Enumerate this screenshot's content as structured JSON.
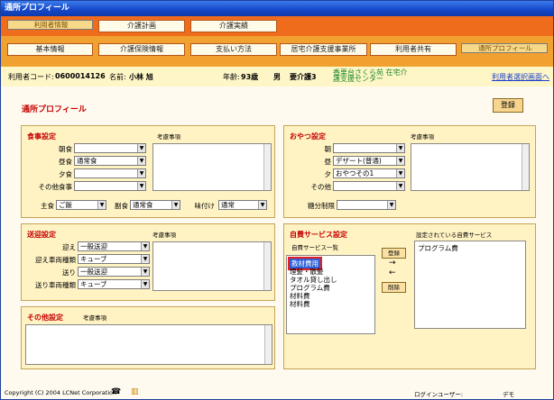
{
  "window": {
    "title": "通所プロフィール"
  },
  "tabs_row1": [
    "利用者情報",
    "介護計画",
    "介護実績"
  ],
  "tabs_row2": [
    "基本情報",
    "介護保険情報",
    "支払い方法",
    "居宅介護支援事業所",
    "利用者共有",
    "通所プロフィール"
  ],
  "user": {
    "code_label": "利用者コード:",
    "code": "0600014126",
    "name_label": "名前:",
    "name": "小林 旭",
    "age_label": "年齢:",
    "age": "93歳",
    "gender": "男",
    "care_level": "要介護3",
    "office": "香栗台さくら苑 在宅介護支援センター",
    "select_link": "利用者選択画面へ"
  },
  "page_title": "通所プロフィール",
  "register_button": "登録",
  "meal": {
    "heading": "食事設定",
    "note": "考慮事項",
    "rows": [
      {
        "label": "朝食",
        "value": ""
      },
      {
        "label": "昼食",
        "value": "通常食"
      },
      {
        "label": "夕食",
        "value": ""
      },
      {
        "label": "その他食事",
        "value": ""
      }
    ],
    "staple_label": "主食",
    "staple": "ご飯",
    "side_label": "副食",
    "side": "通常食",
    "taste_label": "味付け",
    "taste": "通常"
  },
  "snack": {
    "heading": "おやつ設定",
    "note": "考慮事項",
    "rows": [
      {
        "label": "朝",
        "value": ""
      },
      {
        "label": "昼",
        "value": "デザート(普通)"
      },
      {
        "label": "夕",
        "value": "おやつその1"
      },
      {
        "label": "その他",
        "value": ""
      }
    ],
    "sugar_label": "糖分制限",
    "sugar": ""
  },
  "transport": {
    "heading": "送迎設定",
    "note": "考慮事項",
    "rows": [
      {
        "label": "迎え",
        "value": "一般送迎"
      },
      {
        "label": "迎え車両種類",
        "value": "キューブ"
      },
      {
        "label": "送り",
        "value": "一般送迎"
      },
      {
        "label": "送り車両種類",
        "value": "キューブ"
      }
    ]
  },
  "other": {
    "heading": "その他設定",
    "note": "考慮事項"
  },
  "selfpay": {
    "heading": "自費サービス設定",
    "list_label": "自費サービス一覧",
    "set_label": "設定されている自費サービス",
    "list": [
      "教材費用",
      "理髪・散髪",
      "タオル貸し出し",
      "プログラム費",
      "材料費",
      "材料費"
    ],
    "selected": [
      "プログラム費"
    ],
    "add_button": "登録",
    "remove_button": "削除",
    "arrow_right": "→",
    "arrow_left": "←"
  },
  "footer": {
    "copyright": "Copyright (C) 2004 LCNet Corporation",
    "login_label": "ログインユーザー:",
    "login_user": "デモ"
  }
}
